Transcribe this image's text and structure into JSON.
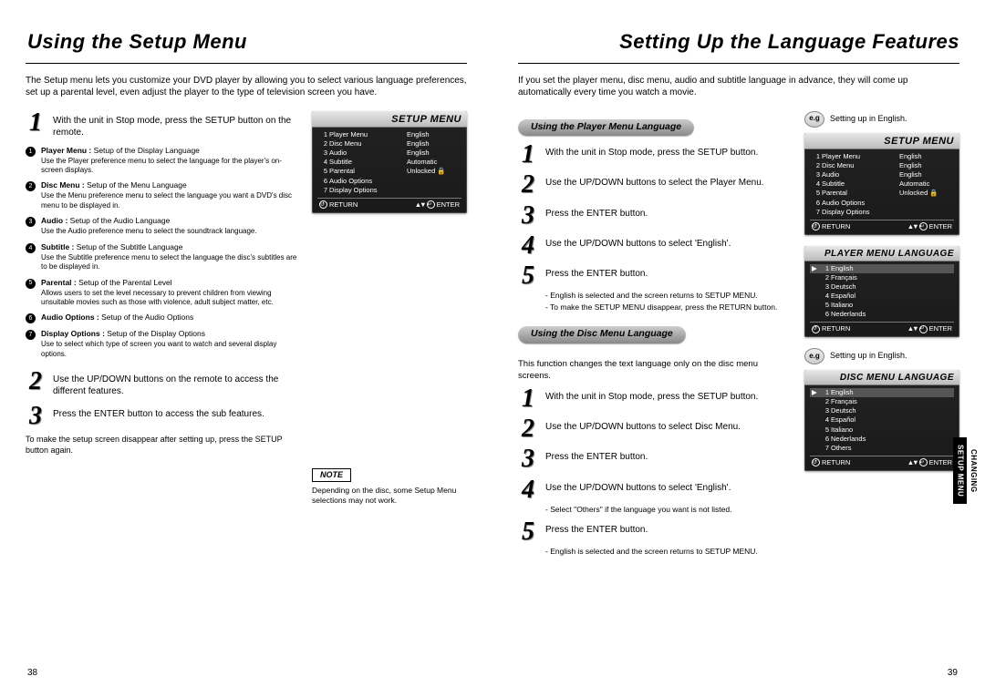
{
  "left": {
    "title": "Using the Setup Menu",
    "intro": "The Setup menu lets you customize your DVD player by allowing you to select various language preferences, set up a parental level, even adjust the player to the type of television screen you have.",
    "steps": [
      {
        "n": "1",
        "t": "With the unit in Stop mode, press the SETUP button on the remote."
      },
      {
        "n": "2",
        "t": "Use the UP/DOWN buttons on the remote to access the different features."
      },
      {
        "n": "3",
        "t": "Press the ENTER button to access the sub features."
      }
    ],
    "defs": [
      {
        "n": "1",
        "title": "Player Menu :",
        "tail": "Setup of the Display Language",
        "sub": "Use the Player preference menu to select the language for the player's on-screen displays."
      },
      {
        "n": "2",
        "title": "Disc Menu :",
        "tail": "Setup of the Menu Language",
        "sub": "Use the Menu preference menu to select the language you want a DVD's disc menu to be displayed in."
      },
      {
        "n": "3",
        "title": "Audio :",
        "tail": "Setup of the Audio Language",
        "sub": "Use the Audio preference menu to select the soundtrack language."
      },
      {
        "n": "4",
        "title": "Subtitle :",
        "tail": "Setup of the Subtitle Language",
        "sub": "Use the Subtitle preference menu to select the language the disc's subtitles are to be displayed in."
      },
      {
        "n": "5",
        "title": "Parental :",
        "tail": "Setup of the Parental Level",
        "sub": "Allows users to set the level necessary to prevent children from viewing unsuitable movies such as those with violence, adult subject matter, etc."
      },
      {
        "n": "6",
        "title": "Audio Options :",
        "tail": "Setup of the Audio Options",
        "sub": ""
      },
      {
        "n": "7",
        "title": "Display Options :",
        "tail": "Setup of the Display Options",
        "sub": "Use to select which type of screen you want to watch and several display options."
      }
    ],
    "after": "To make the setup screen disappear after setting up, press the SETUP button again.",
    "noteLabel": "NOTE",
    "noteText": "Depending on the disc, some Setup Menu selections may not work.",
    "osd": {
      "title": "SETUP MENU",
      "rows": [
        {
          "n": "1",
          "l": "Player Menu",
          "v": "English"
        },
        {
          "n": "2",
          "l": "Disc Menu",
          "v": "English"
        },
        {
          "n": "3",
          "l": "Audio",
          "v": "English"
        },
        {
          "n": "4",
          "l": "Subtitle",
          "v": "Automatic"
        },
        {
          "n": "5",
          "l": "Parental",
          "v": "Unlocked 🔒"
        },
        {
          "n": "6",
          "l": "Audio Options",
          "v": ""
        },
        {
          "n": "7",
          "l": "Display Options",
          "v": ""
        }
      ],
      "footL": "RETURN",
      "footR": "ENTER"
    },
    "pageNum": "38"
  },
  "right": {
    "title": "Setting Up the Language Features",
    "intro": "If you set the player menu, disc menu, audio and subtitle language in advance, they will come up automatically every time you watch a movie.",
    "sec1": {
      "pill": "Using the Player Menu Language",
      "steps": [
        {
          "n": "1",
          "t": "With the unit in Stop mode, press the SETUP button."
        },
        {
          "n": "2",
          "t": "Use the UP/DOWN buttons to select the Player Menu."
        },
        {
          "n": "3",
          "t": "Press the ENTER button."
        },
        {
          "n": "4",
          "t": "Use the UP/DOWN buttons to select 'English'."
        },
        {
          "n": "5",
          "t": "Press the ENTER button."
        }
      ],
      "subA": "- English is selected and the screen returns to SETUP MENU.",
      "subB": "- To make the SETUP MENU disappear, press the RETURN button."
    },
    "sec2": {
      "pill": "Using the Disc Menu Language",
      "lead": "This function changes the text language only on the disc menu screens.",
      "steps": [
        {
          "n": "1",
          "t": "With the unit in Stop mode, press the SETUP button."
        },
        {
          "n": "2",
          "t": "Use the UP/DOWN buttons to select Disc Menu."
        },
        {
          "n": "3",
          "t": "Press the ENTER button."
        },
        {
          "n": "4",
          "t": "Use the UP/DOWN buttons to select 'English'."
        },
        {
          "n": "5",
          "t": "Press the ENTER button."
        }
      ],
      "sub4": "- Select \"Others\" if the language you want is not listed.",
      "sub5": "- English is selected and the screen returns to SETUP MENU."
    },
    "eg": "Setting up in English.",
    "osdSetup": {
      "title": "SETUP MENU",
      "rows": [
        {
          "n": "1",
          "l": "Player Menu",
          "v": "English"
        },
        {
          "n": "2",
          "l": "Disc Menu",
          "v": "English"
        },
        {
          "n": "3",
          "l": "Audio",
          "v": "English"
        },
        {
          "n": "4",
          "l": "Subtitle",
          "v": "Automatic"
        },
        {
          "n": "5",
          "l": "Parental",
          "v": "Unlocked 🔒"
        },
        {
          "n": "6",
          "l": "Audio Options",
          "v": ""
        },
        {
          "n": "7",
          "l": "Display Options",
          "v": ""
        }
      ]
    },
    "osdPlayer": {
      "title": "PLAYER MENU LANGUAGE",
      "rows": [
        {
          "n": "1",
          "l": "English",
          "sel": true
        },
        {
          "n": "2",
          "l": "Français"
        },
        {
          "n": "3",
          "l": "Deutsch"
        },
        {
          "n": "4",
          "l": "Español"
        },
        {
          "n": "5",
          "l": "Italiano"
        },
        {
          "n": "6",
          "l": "Nederlands"
        }
      ]
    },
    "osdDisc": {
      "title": "DISC MENU LANGUAGE",
      "rows": [
        {
          "n": "1",
          "l": "English",
          "sel": true
        },
        {
          "n": "2",
          "l": "Français"
        },
        {
          "n": "3",
          "l": "Deutsch"
        },
        {
          "n": "4",
          "l": "Español"
        },
        {
          "n": "5",
          "l": "Italiano"
        },
        {
          "n": "6",
          "l": "Nederlands"
        },
        {
          "n": "7",
          "l": "Others"
        }
      ]
    },
    "footL": "RETURN",
    "footR": "ENTER",
    "tab1": "CHANGING",
    "tab2": "SETUP MENU",
    "pageNum": "39"
  }
}
